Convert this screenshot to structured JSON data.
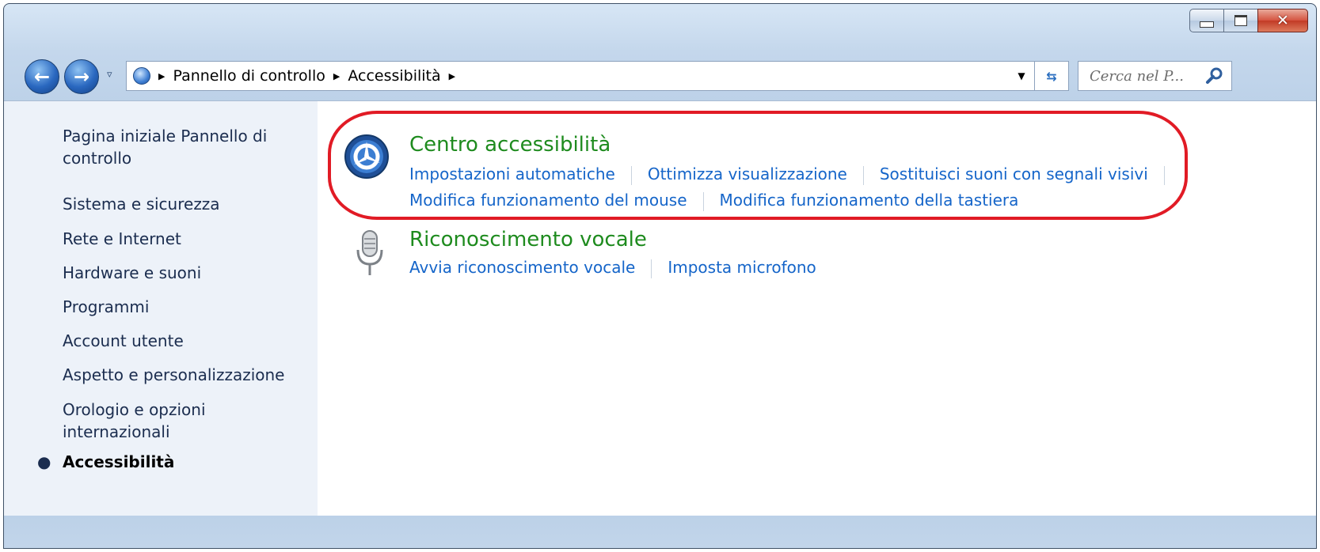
{
  "window": {
    "buttons": {
      "minimize": "minimize",
      "maximize": "maximize",
      "close": "✕"
    }
  },
  "navigation": {
    "breadcrumbs": [
      "Pannello di controllo",
      "Accessibilità"
    ],
    "search_placeholder": "Cerca nel P...",
    "icons": [
      "back-arrow-icon",
      "forward-arrow-icon",
      "recent-pages-chevron-icon",
      "control-panel-icon",
      "address-dropdown-icon",
      "refresh-icon",
      "search-icon"
    ]
  },
  "sidebar": {
    "items": [
      {
        "label": "Pagina iniziale Pannello di controllo"
      },
      {
        "label": "Sistema e sicurezza"
      },
      {
        "label": "Rete e Internet"
      },
      {
        "label": "Hardware e suoni"
      },
      {
        "label": "Programmi"
      },
      {
        "label": "Account utente"
      },
      {
        "label": "Aspetto e personalizzazione"
      },
      {
        "label": "Orologio e opzioni internazionali"
      },
      {
        "label": "Accessibilità",
        "selected": true
      }
    ]
  },
  "categories": [
    {
      "title": "Centro accessibilità",
      "icon": "ease-of-access-icon",
      "links_row1": [
        "Impostazioni automatiche",
        "Ottimizza visualizzazione",
        "Sostituisci suoni con segnali visivi"
      ],
      "links_row2": [
        "Modifica funzionamento del mouse",
        "Modifica funzionamento della tastiera"
      ],
      "highlighted": true
    },
    {
      "title": "Riconoscimento vocale",
      "icon": "microphone-icon",
      "links": [
        "Avvia riconoscimento vocale",
        "Imposta microfono"
      ]
    }
  ],
  "colors": {
    "link": "#1565c9",
    "category_title": "#1e8b1e",
    "highlight": "#e11b25",
    "sidebar_bg": "#edf2f9"
  }
}
